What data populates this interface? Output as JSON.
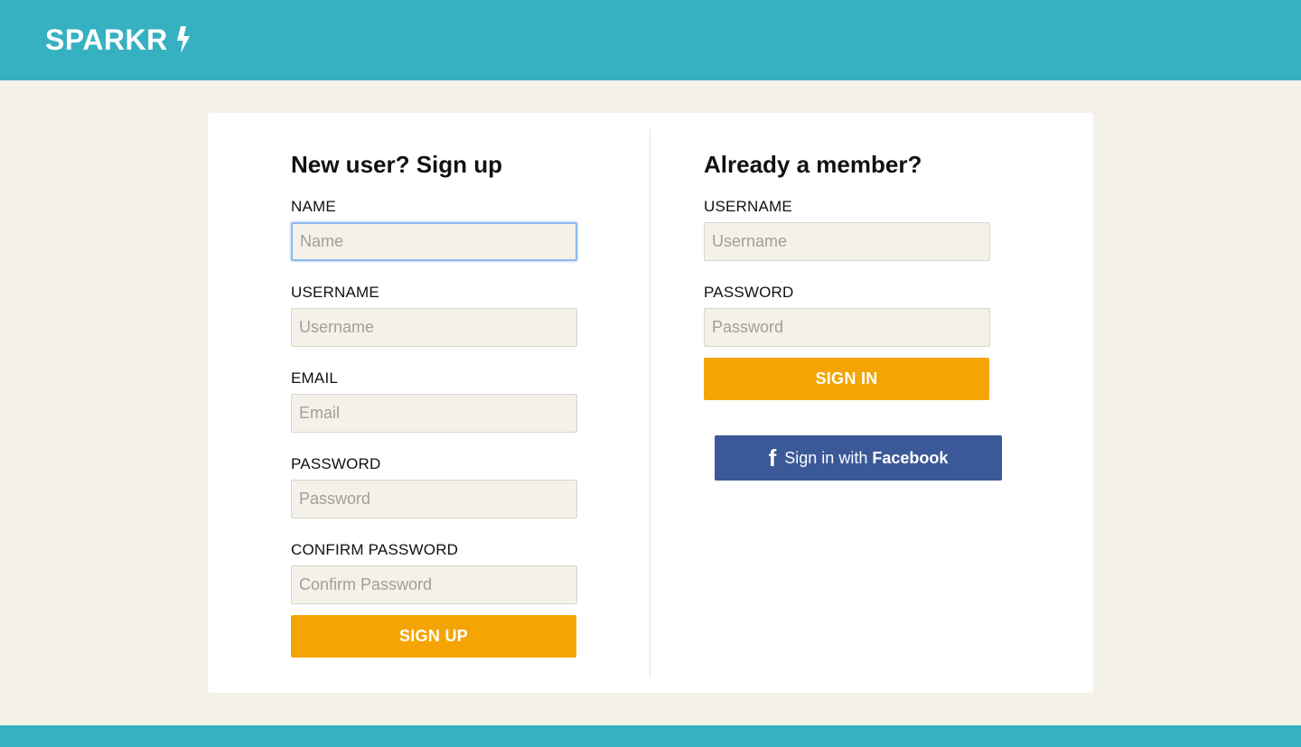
{
  "header": {
    "logo_text": "SPARKR",
    "logo_icon": "lightning-bolt-icon",
    "color": "#36b1c2"
  },
  "signup": {
    "heading": "New user? Sign up",
    "name_label": "NAME",
    "name_placeholder": "Name",
    "username_label": "USERNAME",
    "username_placeholder": "Username",
    "email_label": "EMAIL",
    "email_placeholder": "Email",
    "password_label": "PASSWORD",
    "password_placeholder": "Password",
    "confirm_label": "CONFIRM PASSWORD",
    "confirm_placeholder": "Confirm Password",
    "submit_label": "SIGN UP"
  },
  "signin": {
    "heading": "Already a member?",
    "username_label": "USERNAME",
    "username_placeholder": "Username",
    "password_label": "PASSWORD",
    "password_placeholder": "Password",
    "submit_label": "SIGN IN",
    "facebook_prefix": "Sign in with",
    "facebook_brand": "Facebook",
    "facebook_icon": "facebook-icon"
  },
  "colors": {
    "accent": "#f5a503",
    "facebook": "#3b5998",
    "background": "#f4f1e9"
  }
}
